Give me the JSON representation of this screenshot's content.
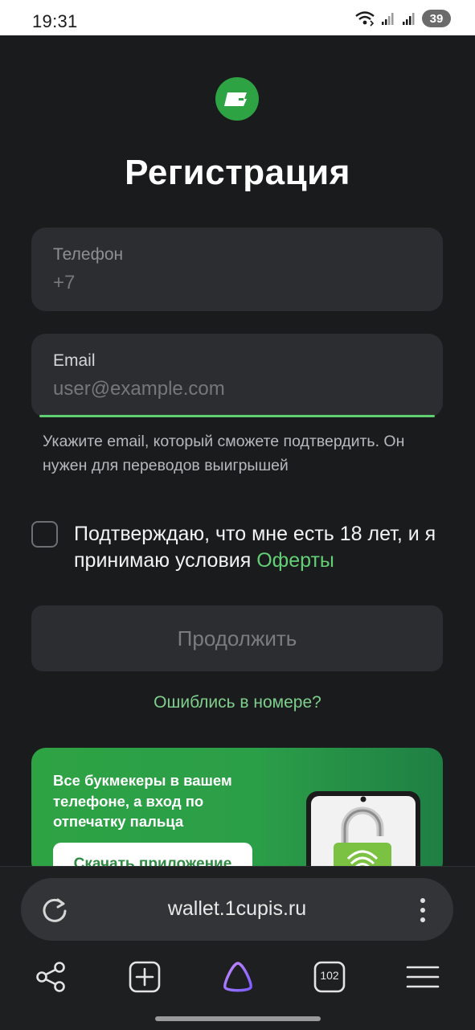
{
  "status_bar": {
    "time": "19:31",
    "battery": "39",
    "icons": [
      "wifi-icon",
      "signal-icon",
      "signal-icon",
      "battery-icon"
    ]
  },
  "page": {
    "logo_icon": "wallet-logo-icon",
    "title": "Регистрация",
    "phone": {
      "label": "Телефон",
      "value": "+7"
    },
    "email": {
      "label": "Email",
      "placeholder": "user@example.com"
    },
    "hint": "Укажите email, который сможете подтвердить. Он нужен для переводов выигрышей",
    "agree_text": "Подтверждаю, что мне есть 18 лет, и я принимаю условия ",
    "agree_link": "Оферты",
    "continue_label": "Продолжить",
    "mistake_link": "Ошиблись в номере?",
    "promo": {
      "text": "Все букмекеры в вашем телефоне, а вход по отпечатку пальца",
      "button": "Скачать приложение"
    }
  },
  "browser": {
    "url": "wallet.1cupis.ru",
    "tabs_count": "102",
    "nav_icons": [
      "share-icon",
      "new-tab-icon",
      "alice-icon",
      "tabs-icon",
      "menu-icon"
    ]
  },
  "colors": {
    "background": "#1a1b1d",
    "field": "#2c2d30",
    "accent_green": "#63cf76",
    "promo_green": "#2ea344"
  }
}
